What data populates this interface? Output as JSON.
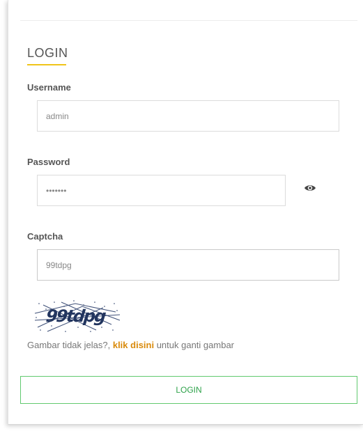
{
  "form": {
    "title": "LOGIN",
    "username": {
      "label": "Username",
      "value": "admin"
    },
    "password": {
      "label": "Password",
      "value": "•••••••",
      "reveal_icon": "eye-icon"
    },
    "captcha": {
      "label": "Captcha",
      "value": "99tdpg",
      "image_text": "99tdpg"
    },
    "hint": {
      "prefix": "Gambar tidak jelas?, ",
      "link": "klik disini",
      "suffix": " untuk ganti gambar"
    },
    "submit_label": "LOGIN"
  },
  "colors": {
    "title_underline": "#f0c419",
    "link": "#d98a0b",
    "submit_border": "#61c96f",
    "submit_text": "#2ea24a",
    "captcha_ink": "#22355f"
  }
}
